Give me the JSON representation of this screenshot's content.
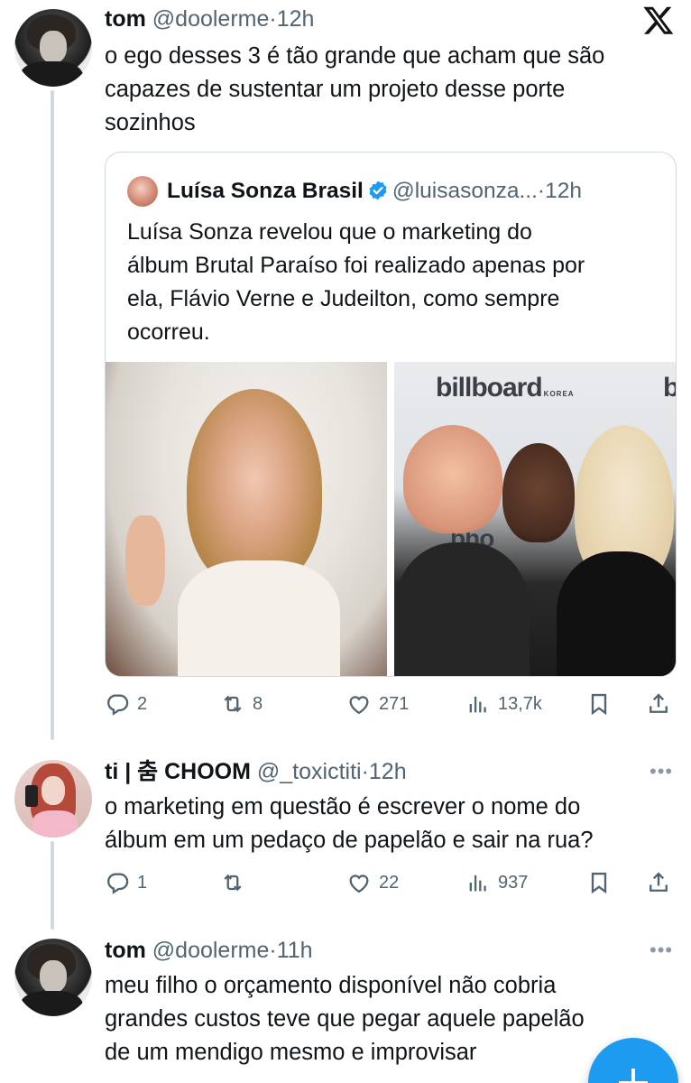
{
  "tweets": [
    {
      "name": "tom",
      "handle": "@doolerme",
      "time": "12h",
      "text_lines": [
        "o ego desses 3 é tão grande que acham que são",
        "capazes de sustentar um projeto desse porte",
        "sozinhos"
      ]
    },
    {
      "name": "ti | 춤 CHOOM",
      "handle": "@_toxictiti",
      "time": "12h",
      "text_lines": [
        "o marketing em questão é escrever o nome do",
        "álbum em um pedaço de papelão e sair na rua?"
      ],
      "actions": {
        "replies": "1",
        "retweets": "",
        "likes": "22",
        "views": "937"
      }
    },
    {
      "name": "tom",
      "handle": "@doolerme",
      "time": "11h",
      "text_lines": [
        "meu filho o orçamento disponível não cobria",
        "grandes custos teve que pegar aquele papelão",
        "de um mendigo mesmo e improvisar"
      ]
    }
  ],
  "quote": {
    "name": "Luísa Sonza Brasil",
    "handle": "@luisasonza...",
    "time": "12h",
    "text_lines": [
      "Luísa Sonza revelou que o marketing do",
      "álbum Brutal Paraíso foi realizado apenas por",
      "ela, Flávio Verne e Judeilton, como sempre",
      "ocorreu."
    ],
    "media_text": {
      "brand": "billboard",
      "brand_sub": "KOREA",
      "brand_fragment": "b",
      "backdrop_fragment": "bho"
    }
  },
  "first_actions": {
    "replies": "2",
    "retweets": "8",
    "likes": "271",
    "views": "13,7k"
  },
  "separator": "·",
  "more_glyph": "•••",
  "colors": {
    "accent": "#1d9bf0",
    "secondary_text": "#536471",
    "thread_line": "#cfd9de"
  },
  "icons": [
    "x-logo-icon",
    "verified-badge-icon",
    "reply-icon",
    "retweet-icon",
    "like-icon",
    "views-icon",
    "bookmark-icon",
    "share-icon",
    "more-icon",
    "compose-icon"
  ]
}
